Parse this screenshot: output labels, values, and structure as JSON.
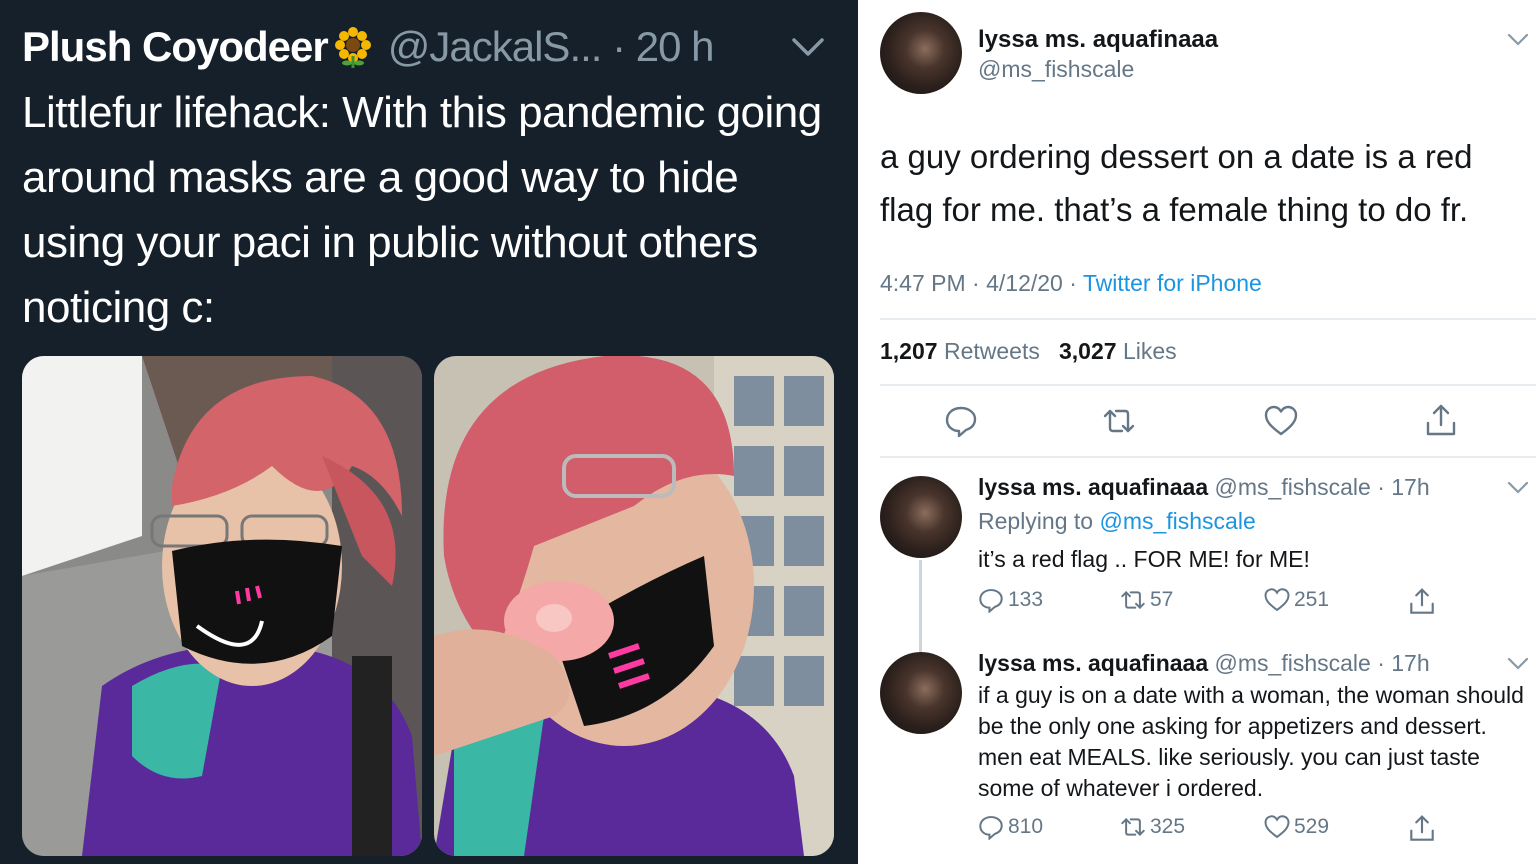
{
  "left_tweet": {
    "display_name": "Plush Coyodeer",
    "handle_time": "@JackalS... · 20 h",
    "text": "Littlefur lifehack: With this pandemic going around masks are a good way to hide using your paci in public without others noticing  c:",
    "icons": [
      "sunflower-emoji",
      "chevron-down-icon"
    ]
  },
  "right_tweet": {
    "display_name": "lyssa ms. aquafinaaa",
    "handle": "@ms_fishscale",
    "text": "a guy ordering dessert on a date is a red flag for me. that’s a female thing to do fr.",
    "meta_time": "4:47 PM · 4/12/20 · ",
    "meta_app": "Twitter for iPhone",
    "retweets_count": "1,207",
    "retweets_label": "Retweets",
    "likes_count": "3,027",
    "likes_label": "Likes",
    "actions": [
      "reply-icon",
      "retweet-icon",
      "like-icon",
      "share-icon"
    ]
  },
  "replies": [
    {
      "display_name": "lyssa ms. aquafinaaa",
      "handle_time": "@ms_fishscale · 17h",
      "replying_prefix": "Replying to ",
      "replying_handle": "@ms_fishscale",
      "text": "it’s a red flag .. FOR ME! for ME!",
      "replies": "133",
      "retweets": "57",
      "likes": "251"
    },
    {
      "display_name": "lyssa ms. aquafinaaa",
      "handle_time": "@ms_fishscale · 17h",
      "text": "if a guy is on a date with a woman, the woman should be the only one asking for appetizers and dessert. men eat MEALS. like seriously. you can just taste some of whatever i ordered.",
      "replies": "810",
      "retweets": "325",
      "likes": "529"
    }
  ],
  "colors": {
    "dark_bg": "#15202b",
    "muted": "#8899a6",
    "link": "#1b95e0",
    "text_light": "#14171a",
    "text_muted_light": "#657786"
  }
}
